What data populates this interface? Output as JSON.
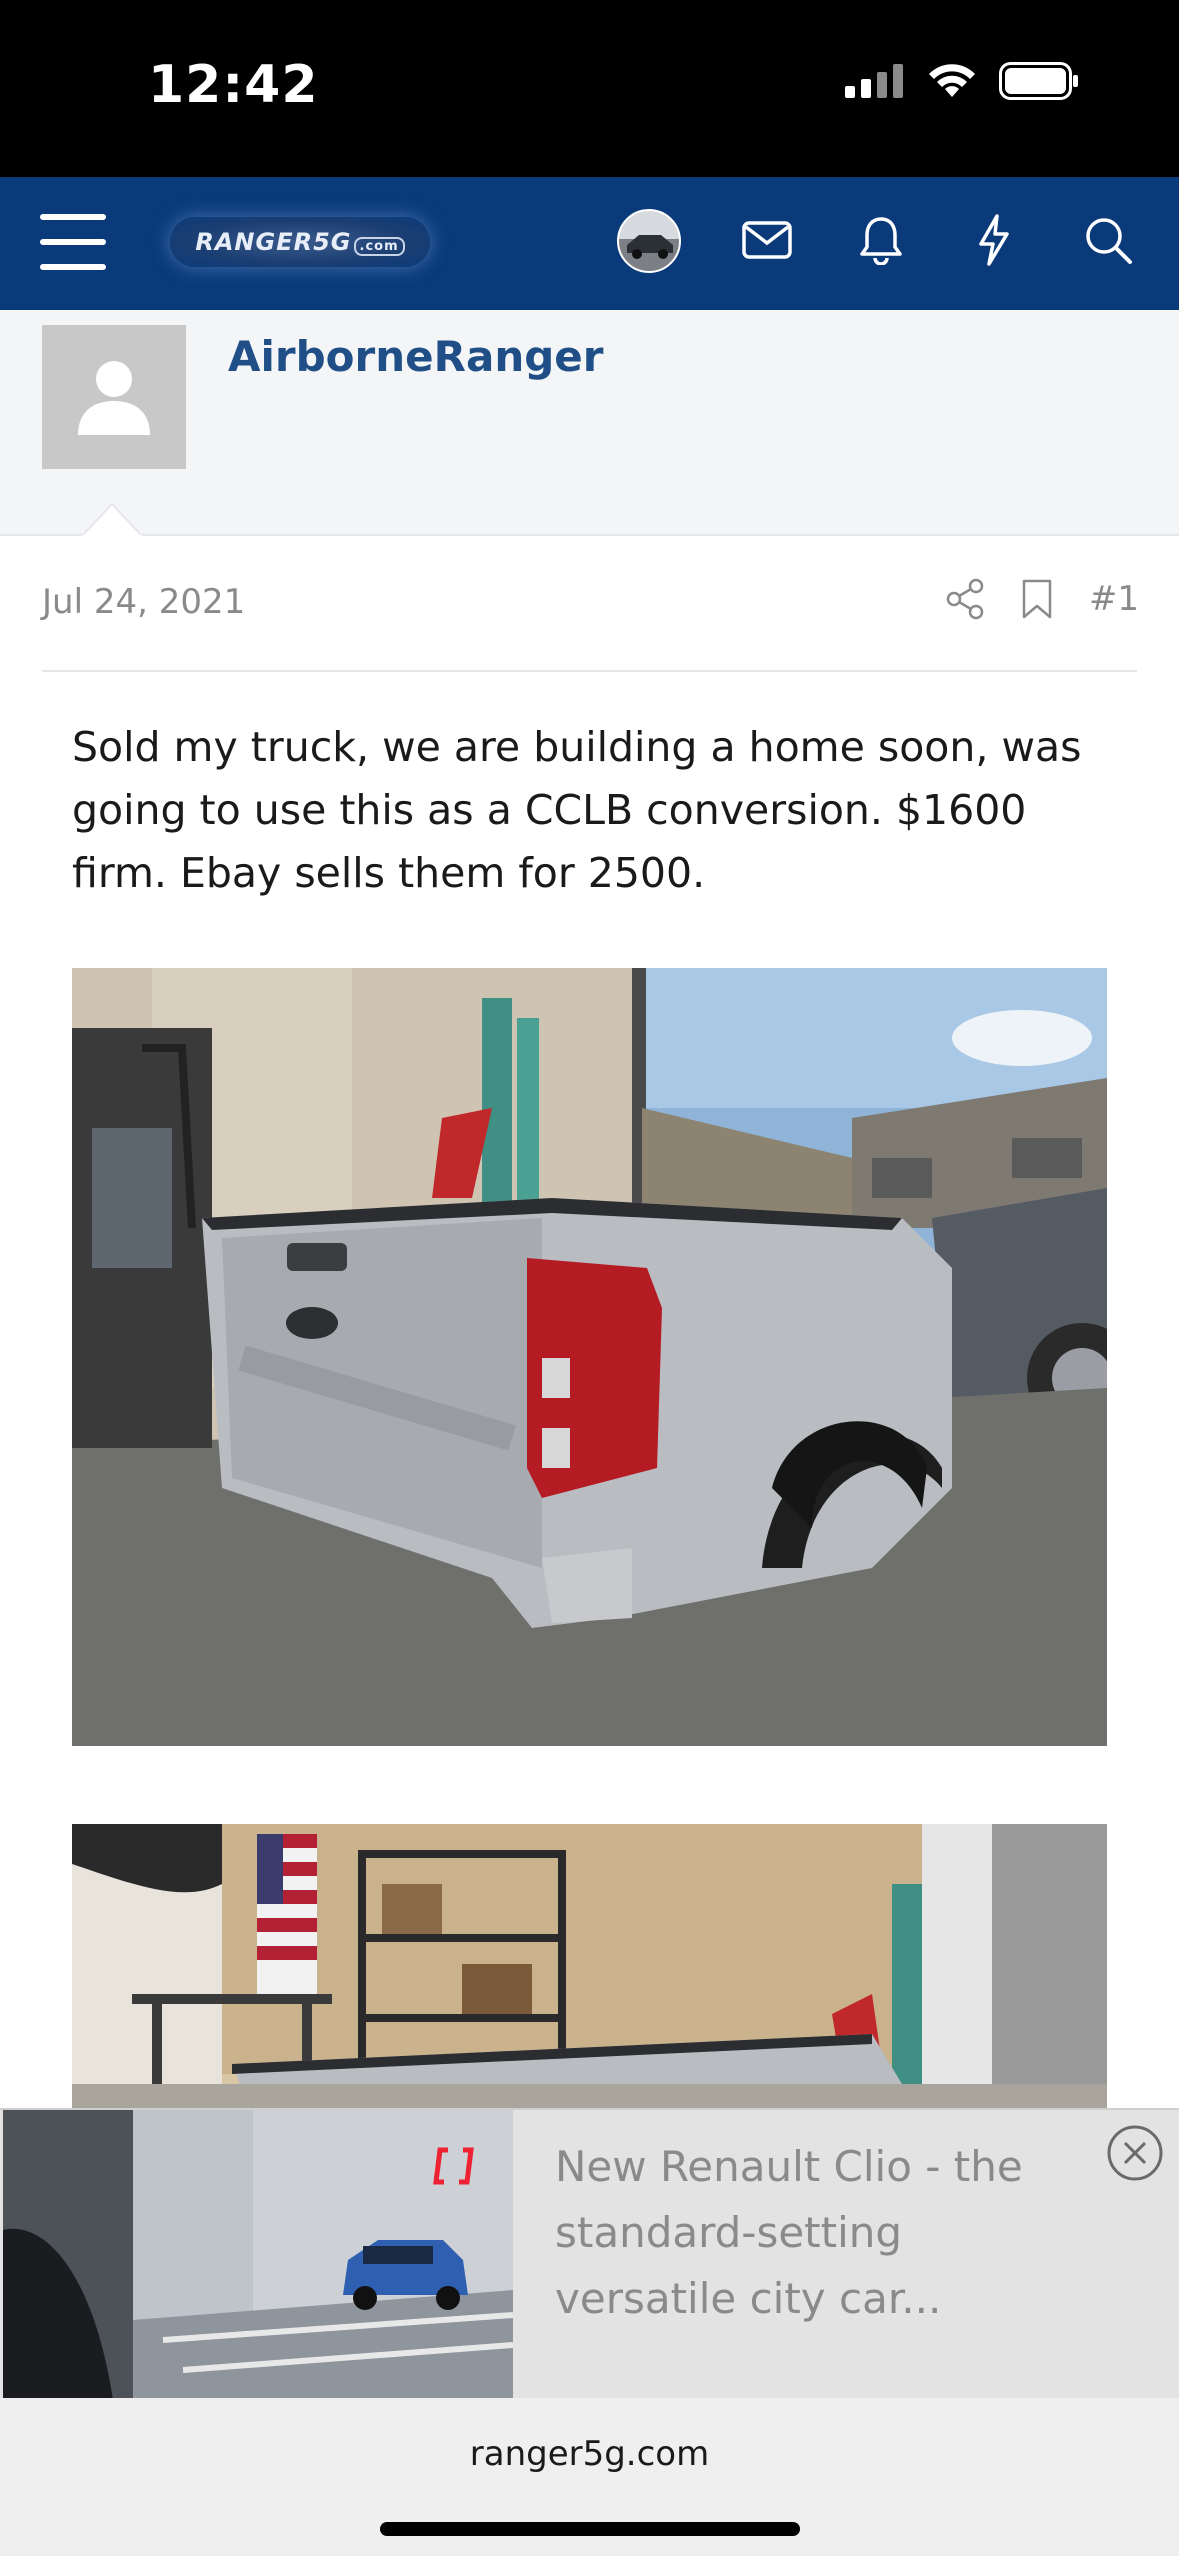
{
  "status_bar": {
    "time": "12:42"
  },
  "header": {
    "logo_text": "RANGER5G",
    "logo_suffix": ".com",
    "icons": [
      "menu-icon",
      "avatar",
      "mail-icon",
      "bell-icon",
      "lightning-icon",
      "search-icon"
    ]
  },
  "user": {
    "name": "AirborneRanger"
  },
  "post": {
    "date": "Jul 24, 2021",
    "number": "#1",
    "body": "Sold my truck, we are building a home soon, was going to use this as a CCLB conversion. $1600 firm. Ebay sells them for 2500.",
    "body_lines": [
      "Sold my truck, we are building a home soon, was",
      "going to use this as a CCLB conversion. $1600",
      "firm. Ebay sells them for 2500."
    ]
  },
  "ad": {
    "text_lines": [
      "New Renault Clio - the",
      "standard-setting",
      "versatile city car..."
    ]
  },
  "browser": {
    "url": "ranger5g.com"
  },
  "colors": {
    "header_bg": "#0a3a7a",
    "username": "#1f4f86",
    "meta_gray": "#8a8a8a"
  }
}
